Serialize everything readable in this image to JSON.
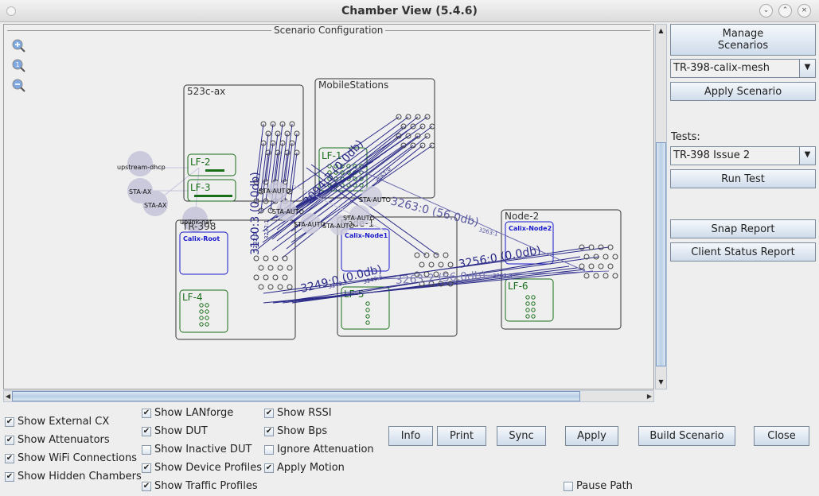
{
  "window": {
    "title": "Chamber View (5.4.6)",
    "controls": [
      "minimize",
      "maximize",
      "close"
    ]
  },
  "canvas": {
    "group_title": "Scenario Configuration",
    "zoom_controls": [
      "zoom-in",
      "zoom-reset",
      "zoom-out"
    ],
    "chambers": [
      {
        "name": "523c-ax",
        "devices": [
          "LF-2",
          "LF-3"
        ]
      },
      {
        "name": "MobileStations",
        "devices": [
          "LF-1"
        ]
      },
      {
        "name": "TR-398",
        "devices": [
          "Calix-Root",
          "LF-4"
        ]
      },
      {
        "name": "Node-1",
        "devices": [
          "Calix-Node1",
          "LF-5"
        ]
      },
      {
        "name": "Node-2",
        "devices": [
          "Calix-Node2",
          "LF-6"
        ]
      }
    ],
    "external_nodes": [
      "upstream-dhcp",
      "STA-AX",
      "STA-AX",
      "uplink-nat"
    ],
    "station_nodes": [
      "STA-AUTO",
      "STA-AUTO",
      "STA-AUTO",
      "STA-AUTO",
      "STA-AUTO",
      "STA-AUTO"
    ],
    "link_labels": {
      "big": [
        "3100:3 (0.0db)",
        "3094:3 (0.0db)",
        "3263:0 (56.0db)",
        "3249:0 (0.0db)",
        "3256:0 (0.0db)",
        "3263:2 (56.0db)"
      ],
      "small": [
        "3263:1",
        "3263:3",
        "3262:0",
        "3249:2",
        "3249:3",
        "3232:0",
        "3232:1"
      ]
    }
  },
  "side_panel": {
    "manage_scenarios": "Manage\nScenarios",
    "scenario_select": "TR-398-calix-mesh",
    "apply_scenario": "Apply Scenario",
    "tests_label": "Tests:",
    "test_select": "TR-398 Issue 2",
    "run_test": "Run Test",
    "snap_report": "Snap Report",
    "client_status_report": "Client Status Report"
  },
  "options": {
    "col1": [
      {
        "label": "Show External CX",
        "checked": true
      },
      {
        "label": "Show Attenuators",
        "checked": true
      },
      {
        "label": "Show WiFi Connections",
        "checked": true
      },
      {
        "label": "Show Hidden Chambers",
        "checked": true
      }
    ],
    "col2": [
      {
        "label": "Show LANforge",
        "checked": true
      },
      {
        "label": "Show DUT",
        "checked": true
      },
      {
        "label": "Show Inactive DUT",
        "checked": false
      },
      {
        "label": "Show Device Profiles",
        "checked": true
      },
      {
        "label": "Show Traffic Profiles",
        "checked": true
      }
    ],
    "col3": [
      {
        "label": "Show RSSI",
        "checked": true
      },
      {
        "label": "Show Bps",
        "checked": true
      },
      {
        "label": "Ignore Attenuation",
        "checked": false
      },
      {
        "label": "Apply Motion",
        "checked": true
      }
    ],
    "pause_path": {
      "label": "Pause Path",
      "checked": false
    }
  },
  "buttons": {
    "info": "Info",
    "print": "Print",
    "sync": "Sync",
    "apply": "Apply",
    "build_scenario": "Build Scenario",
    "close": "Close"
  }
}
